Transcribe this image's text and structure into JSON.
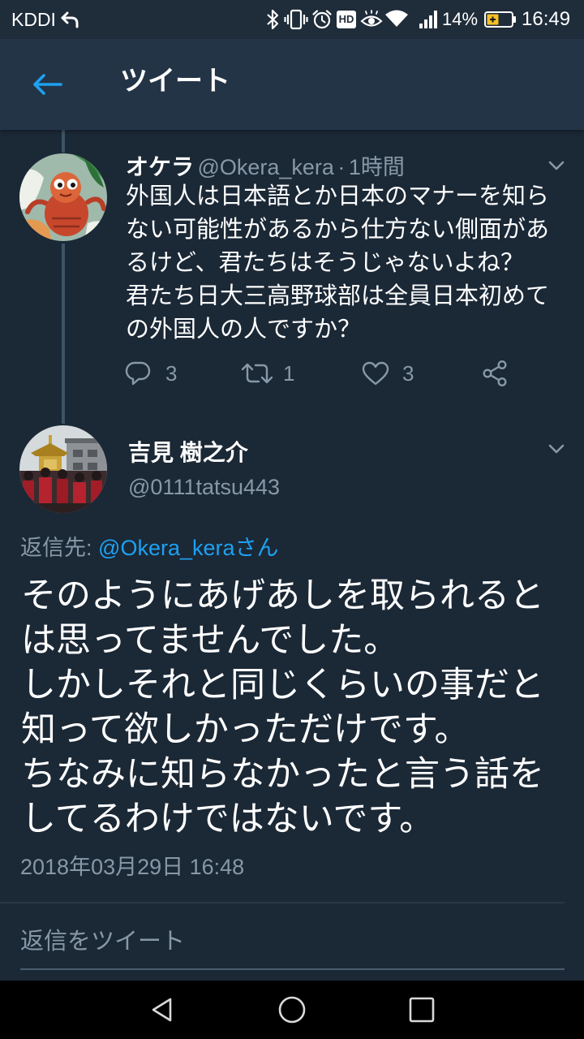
{
  "status_bar": {
    "carrier": "KDDI",
    "hd_badge": "HD",
    "battery": "14%",
    "time": "16:49",
    "icons": [
      "carrier-arrow-icon",
      "bluetooth-icon",
      "vibrate-icon",
      "alarm-icon",
      "eye-icon",
      "wifi-icon",
      "signal-icon",
      "battery-icon"
    ]
  },
  "header": {
    "title": "ツイート",
    "back_icon": "back-arrow-icon"
  },
  "parent_tweet": {
    "name": "オケラ",
    "handle": "@Okera_kera",
    "separator": "·",
    "time": "1時間",
    "menu_icon": "chevron-down-icon",
    "lines": [
      "外国人は日本語とか日本のマナーを知ら",
      "ない可能性があるから仕方ない側面があ",
      "るけど、君たちはそうじゃないよね？",
      "君たち日大三高野球部は全員日本初めて",
      "の外国人の人ですか？"
    ],
    "actions": {
      "reply_count": "3",
      "retweet_count": "1",
      "like_count": "3",
      "icons": [
        "reply-icon",
        "retweet-icon",
        "heart-icon",
        "share-icon"
      ]
    }
  },
  "focused_tweet": {
    "name": "吉見 樹之介",
    "handle": "@0111tatsu443",
    "menu_icon": "chevron-down-icon",
    "reply_to_label": "返信先:",
    "reply_to_user": "@Okera_keraさん",
    "lines": [
      "そのようにあげあしを取られると",
      "は思ってませんでした。",
      "しかしそれと同じくらいの事だと",
      "知って欲しかっただけです。",
      "ちなみに知らなかったと言う話を",
      "してるわけではないです。"
    ],
    "timestamp": "2018年03月29日 16:48"
  },
  "reply_box": {
    "placeholder": "返信をツイート"
  },
  "nav_bar": {
    "icons": [
      "nav-back-icon",
      "nav-home-icon",
      "nav-recents-icon"
    ]
  },
  "colors": {
    "bg": "#1b2836",
    "header": "#243447",
    "statusbar": "#1f2c3a",
    "text": "#ffffff",
    "text2": "#8899a6",
    "accent": "#1da1f2",
    "line": "#3d5466",
    "divider": "#2a3846",
    "underline": "#4a5d70",
    "nav": "#000000"
  }
}
